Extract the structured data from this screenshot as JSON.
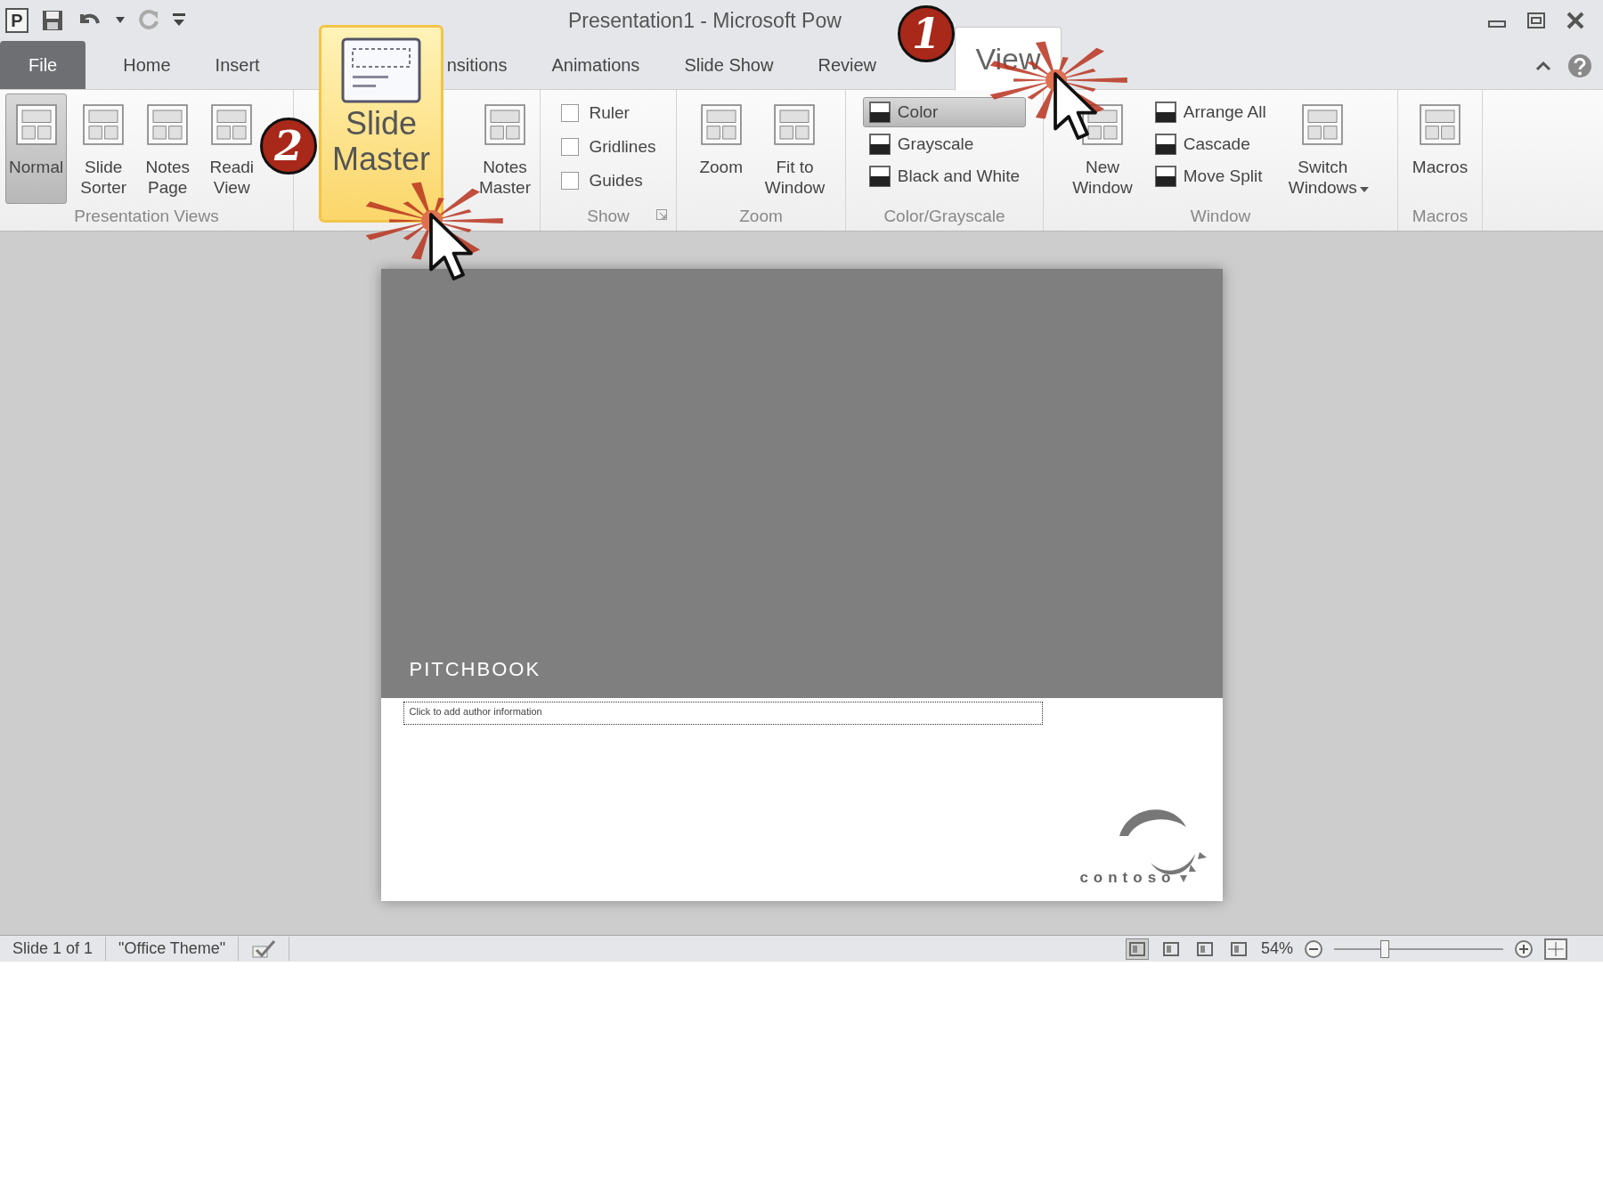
{
  "window": {
    "app_letter": "P",
    "title": "Presentation1 - Microsoft Pow"
  },
  "tabs": [
    {
      "label": "File",
      "kind": "file",
      "selected": false
    },
    {
      "label": "Home",
      "kind": "plain",
      "selected": false
    },
    {
      "label": "Insert",
      "kind": "plain",
      "selected": false
    },
    {
      "label": "nsitions",
      "kind": "plain",
      "selected": false
    },
    {
      "label": "Animations",
      "kind": "plain",
      "selected": false
    },
    {
      "label": "Slide Show",
      "kind": "plain",
      "selected": false
    },
    {
      "label": "Review",
      "kind": "plain",
      "selected": false
    },
    {
      "label": "View",
      "kind": "plain",
      "selected": true
    }
  ],
  "ribbon": {
    "groups": [
      {
        "label": "Presentation Views",
        "items": [
          {
            "kind": "large",
            "lines": [
              "Normal"
            ],
            "selected": true
          },
          {
            "kind": "large",
            "lines": [
              "Slide",
              "Sorter"
            ],
            "selected": false
          },
          {
            "kind": "large",
            "lines": [
              "Notes",
              "Page"
            ],
            "selected": false
          },
          {
            "kind": "large",
            "lines": [
              "Readi",
              "View"
            ],
            "selected": false
          }
        ]
      },
      {
        "items": [
          {
            "kind": "large",
            "lines": [
              "Notes",
              "Master"
            ],
            "selected": false
          }
        ]
      },
      {
        "label": "Show",
        "launcher": true,
        "items": [
          {
            "kind": "check",
            "label": "Ruler",
            "checked": false
          },
          {
            "kind": "check",
            "label": "Gridlines",
            "checked": false
          },
          {
            "kind": "check",
            "label": "Guides",
            "checked": false
          }
        ]
      },
      {
        "label": "Zoom",
        "items": [
          {
            "kind": "large",
            "lines": [
              "Zoom"
            ],
            "selected": false
          },
          {
            "kind": "large",
            "lines": [
              "Fit to",
              "Window"
            ],
            "selected": false
          }
        ]
      },
      {
        "label": "Color/Grayscale",
        "items": [
          {
            "kind": "small",
            "label": "Color",
            "selected": true
          },
          {
            "kind": "small",
            "label": "Grayscale",
            "selected": false
          },
          {
            "kind": "small",
            "label": "Black and White",
            "selected": false
          }
        ]
      },
      {
        "label": "Window",
        "items": [
          {
            "kind": "large",
            "lines": [
              "New",
              "Window"
            ],
            "selected": false
          },
          {
            "kind": "small",
            "label": "Arrange All",
            "selected": false
          },
          {
            "kind": "small",
            "label": "Cascade",
            "selected": false
          },
          {
            "kind": "small",
            "label": "Move Split",
            "selected": false
          },
          {
            "kind": "large",
            "lines": [
              "Switch",
              "Windows"
            ],
            "dropdown": true,
            "selected": false
          }
        ]
      },
      {
        "label": "Macros",
        "items": [
          {
            "kind": "large",
            "lines": [
              "Macros"
            ],
            "selected": false
          }
        ]
      }
    ]
  },
  "slide_master_callout": {
    "lines": [
      "Slide",
      "Master"
    ]
  },
  "step_badges": [
    {
      "number": "1"
    },
    {
      "number": "2"
    }
  ],
  "slide": {
    "title": "PITCHBOOK",
    "author_placeholder": "Click to add author information",
    "logo": "contoso"
  },
  "status_bar": {
    "slide_info": "Slide 1 of 1",
    "theme": "\"Office Theme\"",
    "view_buttons": [
      {
        "selected": true
      },
      {
        "selected": false
      },
      {
        "selected": false
      },
      {
        "selected": false
      }
    ],
    "zoom": "54%",
    "zoom_slider": {
      "level": 0.3
    }
  }
}
